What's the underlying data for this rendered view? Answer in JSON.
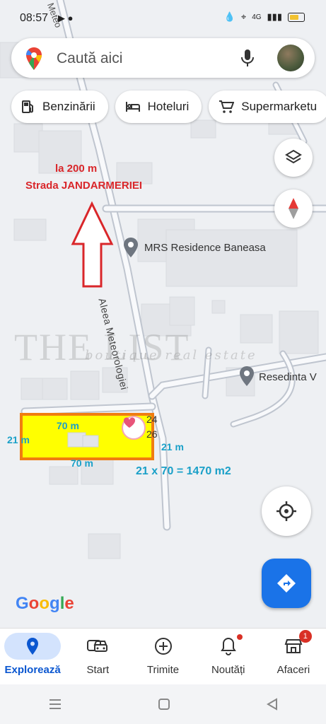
{
  "status": {
    "time": "08:57",
    "network": "4G"
  },
  "search": {
    "placeholder": "Caută aici"
  },
  "chips": [
    {
      "label": "Benzinării",
      "icon": "fuel-icon"
    },
    {
      "label": "Hoteluri",
      "icon": "bed-icon"
    },
    {
      "label": "Supermarketu",
      "icon": "cart-icon"
    }
  ],
  "map": {
    "street_top": "Meteo",
    "street_main": "Aleea Meteorologiei",
    "poi_1": "MRS Residence Baneasa",
    "poi_2": "Resedinta V",
    "house_numbers": {
      "a": "24",
      "b": "26"
    }
  },
  "annotations": {
    "line1": "la 200 m",
    "line2": "Strada JANDARMERIEI",
    "top_len": "70 m",
    "bottom_len": "70 m",
    "left_w": "21 m",
    "right_w": "21 m",
    "area": "21 x 70 = 1470 m2"
  },
  "watermark": {
    "main": "THE LIST",
    "sub": "boutique real estate"
  },
  "brand": {
    "logo": "Google"
  },
  "nav": [
    {
      "label": "Explorează",
      "icon": "explore-pin-icon",
      "active": true
    },
    {
      "label": "Start",
      "icon": "car-icon"
    },
    {
      "label": "Trimite",
      "icon": "add-circle-icon"
    },
    {
      "label": "Noutăți",
      "icon": "bell-icon"
    },
    {
      "label": "Afaceri",
      "icon": "store-icon",
      "badge": "1"
    }
  ],
  "colors": {
    "accent": "#1a73e8",
    "annotation_red": "#d9262a",
    "annotation_blue": "#1aa0c8",
    "parcel_fill": "#ffff00",
    "parcel_border": "#f07d10"
  }
}
